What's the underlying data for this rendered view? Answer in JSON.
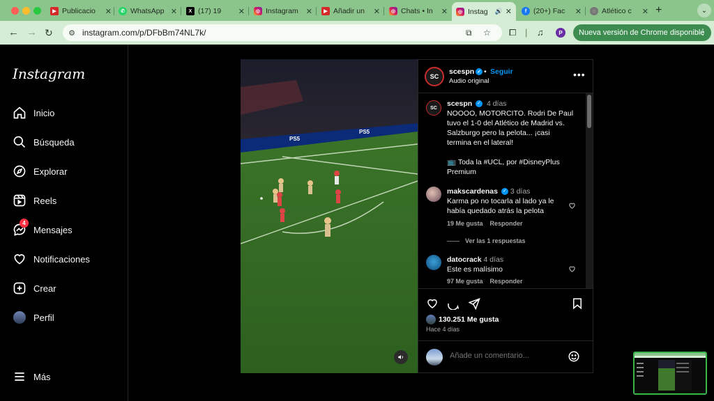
{
  "browser": {
    "tabs": [
      {
        "label": "Publicacio",
        "icon": "youtube-studio-icon"
      },
      {
        "label": "WhatsApp",
        "icon": "whatsapp-icon"
      },
      {
        "label": "(17) 19",
        "icon": "x-icon"
      },
      {
        "label": "Instagram",
        "icon": "instagram-icon"
      },
      {
        "label": "Añadir un",
        "icon": "youtube-studio-icon"
      },
      {
        "label": "Chats • In",
        "icon": "instagram-icon"
      },
      {
        "label": "Instag",
        "icon": "instagram-icon"
      },
      {
        "label": "(20+) Fac",
        "icon": "facebook-icon"
      },
      {
        "label": "Atlético c",
        "icon": "globe-icon"
      }
    ],
    "url": "instagram.com/p/DFbBm74NL7k/",
    "update_label": "Nueva versión de Chrome disponible",
    "profile_initial": "P"
  },
  "sidebar": {
    "logo": "Instagram",
    "items": [
      {
        "label": "Inicio"
      },
      {
        "label": "Búsqueda"
      },
      {
        "label": "Explorar"
      },
      {
        "label": "Reels"
      },
      {
        "label": "Mensajes",
        "badge": "4"
      },
      {
        "label": "Notificaciones"
      },
      {
        "label": "Crear"
      },
      {
        "label": "Perfil"
      }
    ],
    "more": "Más"
  },
  "post": {
    "author": "scespn",
    "author_avatar_text": "SC",
    "follow_label": "Seguir",
    "dot": "•",
    "audio": "Audio original",
    "more_icon": "•••",
    "caption": {
      "user": "scespn",
      "time": "4 días",
      "text": "NOOOO, MOTORCITO. Rodri De Paul tuvo el 1-0 del Atlético de Madrid vs. Salzburgo pero la pelota... ¡casi termina en el lateral!",
      "text2": "Toda la #UCL, por #DisneyPlus Premium"
    },
    "comments": [
      {
        "user": "makscardenas",
        "time": "3 días",
        "text": "Karma po no tocarla al lado ya le había quedado atrás la pelota",
        "likes": "19 Me gusta",
        "reply": "Responder"
      },
      {
        "user": "datocrack",
        "time": "4 días",
        "text": "Este es malísimo",
        "likes": "97 Me gusta",
        "reply": "Responder"
      }
    ],
    "view_replies": "Ver las 1 respuestas",
    "like_count": "130.251 Me gusta",
    "ago": "Hace 4 días",
    "comment_placeholder": "Añade un comentario..."
  },
  "video": {
    "board_text_1": "PS5",
    "board_text_2": "PS5"
  },
  "colors": {
    "accent_blue": "#0095f6",
    "badge_red": "#ff3040",
    "chrome_green": "#8cc58c"
  }
}
